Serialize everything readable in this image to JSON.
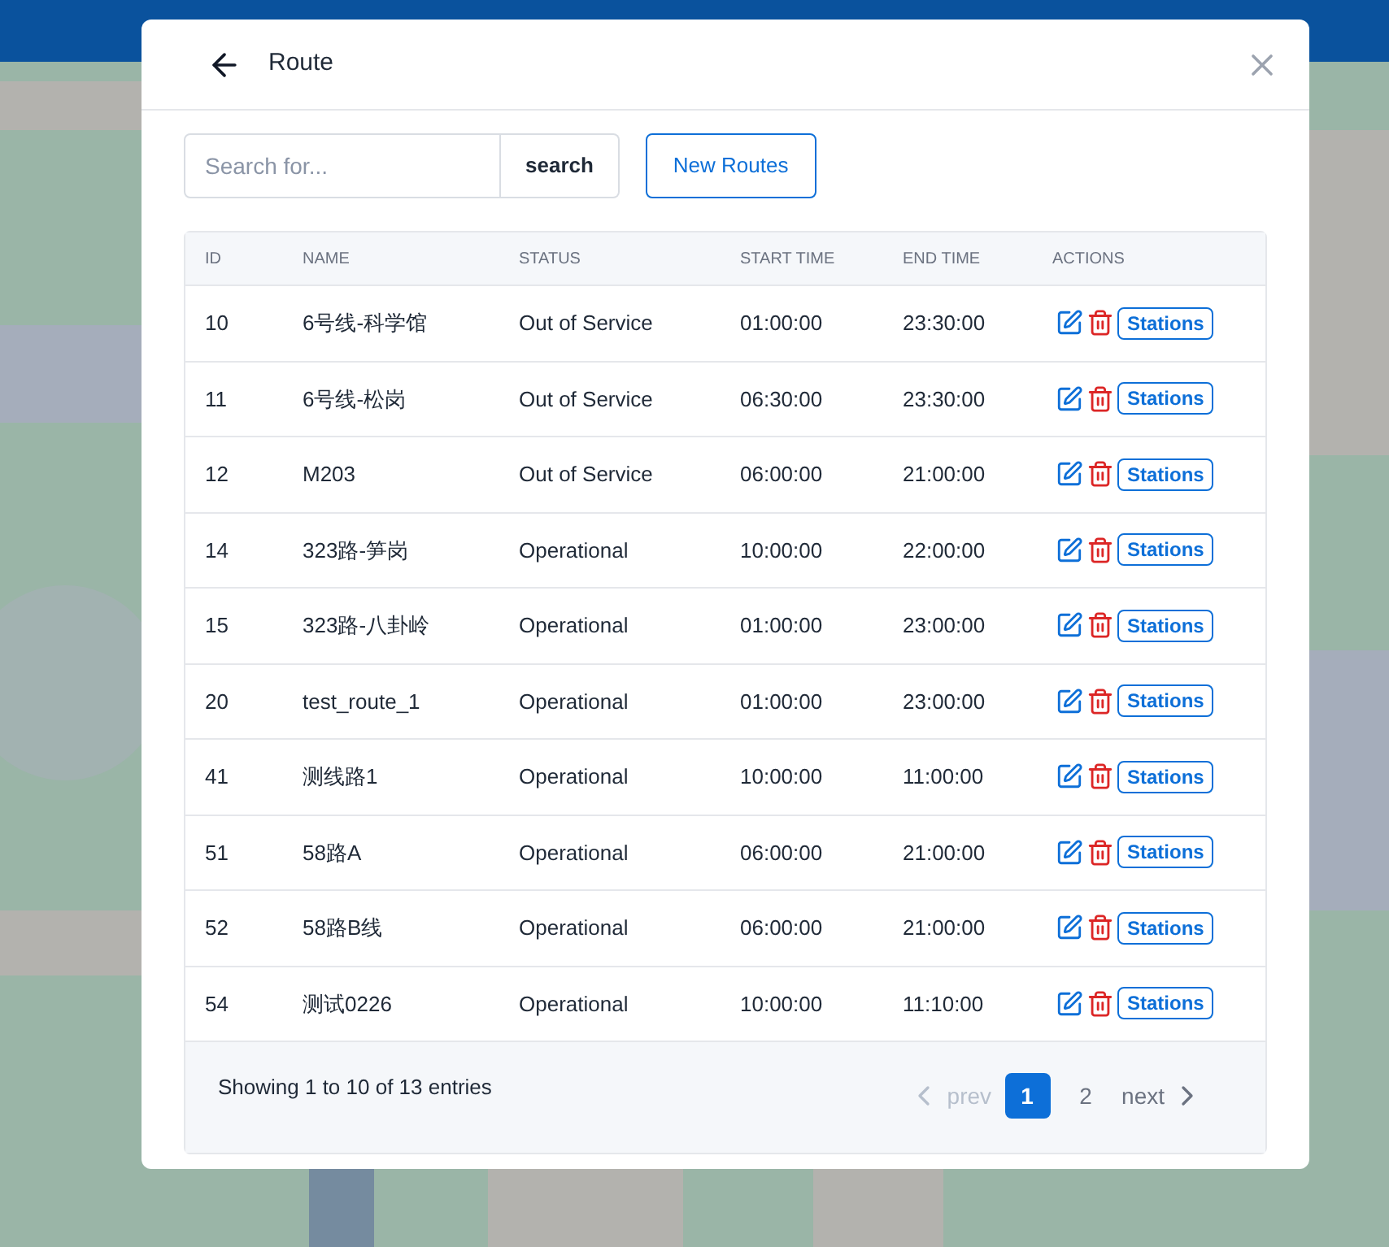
{
  "dialog": {
    "title": "Route"
  },
  "search": {
    "placeholder": "Search for...",
    "button": "search"
  },
  "new_button": "New Routes",
  "table": {
    "columns": [
      "ID",
      "NAME",
      "STATUS",
      "START TIME",
      "END TIME",
      "ACTIONS"
    ],
    "rows": [
      {
        "id": "10",
        "name": "6号线-科学馆",
        "status": "Out of Service",
        "start": "01:00:00",
        "end": "23:30:00",
        "action": "Stations"
      },
      {
        "id": "11",
        "name": "6号线-松岗",
        "status": "Out of Service",
        "start": "06:30:00",
        "end": "23:30:00",
        "action": "Stations"
      },
      {
        "id": "12",
        "name": "M203",
        "status": "Out of Service",
        "start": "06:00:00",
        "end": "21:00:00",
        "action": "Stations"
      },
      {
        "id": "14",
        "name": "323路-笋岗",
        "status": "Operational",
        "start": "10:00:00",
        "end": "22:00:00",
        "action": "Stations"
      },
      {
        "id": "15",
        "name": "323路-八卦岭",
        "status": "Operational",
        "start": "01:00:00",
        "end": "23:00:00",
        "action": "Stations"
      },
      {
        "id": "20",
        "name": "test_route_1",
        "status": "Operational",
        "start": "01:00:00",
        "end": "23:00:00",
        "action": "Stations"
      },
      {
        "id": "41",
        "name": "测线路1",
        "status": "Operational",
        "start": "10:00:00",
        "end": "11:00:00",
        "action": "Stations"
      },
      {
        "id": "51",
        "name": "58路A",
        "status": "Operational",
        "start": "06:00:00",
        "end": "21:00:00",
        "action": "Stations"
      },
      {
        "id": "52",
        "name": "58路B线",
        "status": "Operational",
        "start": "06:00:00",
        "end": "21:00:00",
        "action": "Stations"
      },
      {
        "id": "54",
        "name": "测试0226",
        "status": "Operational",
        "start": "10:00:00",
        "end": "11:10:00",
        "action": "Stations"
      }
    ]
  },
  "footer": {
    "summary": "Showing 1 to 10 of 13 entries",
    "prev": {
      "label": "prev",
      "disabled": true
    },
    "pages": [
      {
        "label": "1",
        "selected": true
      },
      {
        "label": "2",
        "selected": false
      }
    ],
    "next": {
      "label": "next",
      "disabled": false
    }
  }
}
